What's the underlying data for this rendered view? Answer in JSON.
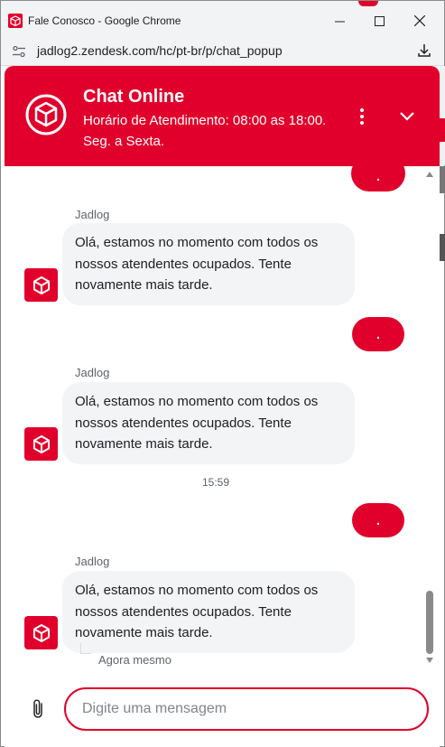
{
  "window": {
    "title": "Fale Conosco - Google Chrome",
    "url": "jadlog2.zendesk.com/hc/pt-br/p/chat_popup"
  },
  "header": {
    "title": "Chat Online",
    "subtitle": "Horário de Atendimento: 08:00 as 18:00. Seg. a Sexta."
  },
  "messages": {
    "user_bubble_text": ".",
    "bot_sender": "Jadlog",
    "bot_text": "Olá, estamos no momento com todos os nossos atendentes ocupados. Tente novamente mais tarde.",
    "timestamp": "15:59",
    "status": "Agora mesmo"
  },
  "composer": {
    "placeholder": "Digite uma mensagem"
  },
  "colors": {
    "brand": "#e0002b",
    "bot_bubble": "#f3f4f6"
  },
  "icons": {
    "app": "jadlog-box-icon",
    "site_info": "tune-icon",
    "download": "download-icon",
    "menu": "kebab-menu-icon",
    "collapse": "chevron-down-icon",
    "attach": "paperclip-icon"
  }
}
